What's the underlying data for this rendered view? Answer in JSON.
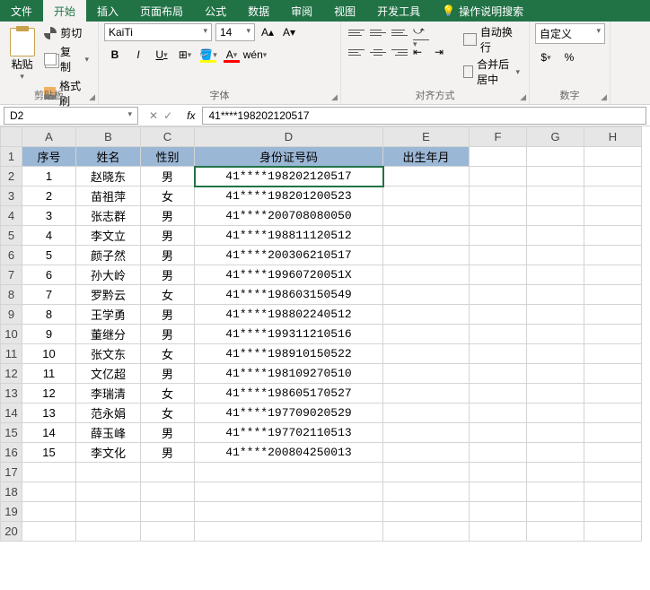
{
  "tabs": {
    "file": "文件",
    "home": "开始",
    "insert": "插入",
    "layout": "页面布局",
    "formula": "公式",
    "data": "数据",
    "review": "审阅",
    "view": "视图",
    "dev": "开发工具",
    "tell": "操作说明搜索"
  },
  "ribbon": {
    "paste": "粘贴",
    "cut": "剪切",
    "copy": "复制",
    "painter": "格式刷",
    "clipboard": "剪贴板",
    "fontName": "KaiTi",
    "fontSize": "14",
    "fontGroup": "字体",
    "b": "B",
    "i": "I",
    "u": "U",
    "wen": "wén",
    "wrap": "自动换行",
    "merge": "合并后居中",
    "alignGroup": "对齐方式",
    "numFormat": "自定义",
    "numGroup": "数字"
  },
  "nameBox": "D2",
  "formula": "41****198202120517",
  "columns": [
    "A",
    "B",
    "C",
    "D",
    "E",
    "F",
    "G",
    "H"
  ],
  "headers": {
    "c1": "序号",
    "c2": "姓名",
    "c3": "性别",
    "c4": "身份证号码",
    "c5": "出生年月"
  },
  "rows": [
    {
      "n": "1",
      "name": "赵晓东",
      "sex": "男",
      "id": "41****198202120517"
    },
    {
      "n": "2",
      "name": "苗祖萍",
      "sex": "女",
      "id": "41****198201200523"
    },
    {
      "n": "3",
      "name": "张志群",
      "sex": "男",
      "id": "41****200708080050"
    },
    {
      "n": "4",
      "name": "李文立",
      "sex": "男",
      "id": "41****198811120512"
    },
    {
      "n": "5",
      "name": "颜子然",
      "sex": "男",
      "id": "41****200306210517"
    },
    {
      "n": "6",
      "name": "孙大岭",
      "sex": "男",
      "id": "41****19960720051X"
    },
    {
      "n": "7",
      "name": "罗黔云",
      "sex": "女",
      "id": "41****198603150549"
    },
    {
      "n": "8",
      "name": "王学勇",
      "sex": "男",
      "id": "41****198802240512"
    },
    {
      "n": "9",
      "name": "董继分",
      "sex": "男",
      "id": "41****199311210516"
    },
    {
      "n": "10",
      "name": "张文东",
      "sex": "女",
      "id": "41****198910150522"
    },
    {
      "n": "11",
      "name": "文亿超",
      "sex": "男",
      "id": "41****198109270510"
    },
    {
      "n": "12",
      "name": "李瑞清",
      "sex": "女",
      "id": "41****198605170527"
    },
    {
      "n": "13",
      "name": "范永娟",
      "sex": "女",
      "id": "41****197709020529"
    },
    {
      "n": "14",
      "name": "薛玉峰",
      "sex": "男",
      "id": "41****197702110513"
    },
    {
      "n": "15",
      "name": "李文化",
      "sex": "男",
      "id": "41****200804250013"
    }
  ],
  "chart_data": {
    "type": "table",
    "columns": [
      "序号",
      "姓名",
      "性别",
      "身份证号码",
      "出生年月"
    ],
    "data": [
      [
        1,
        "赵晓东",
        "男",
        "41****198202120517",
        ""
      ],
      [
        2,
        "苗祖萍",
        "女",
        "41****198201200523",
        ""
      ],
      [
        3,
        "张志群",
        "男",
        "41****200708080050",
        ""
      ],
      [
        4,
        "李文立",
        "男",
        "41****198811120512",
        ""
      ],
      [
        5,
        "颜子然",
        "男",
        "41****200306210517",
        ""
      ],
      [
        6,
        "孙大岭",
        "男",
        "41****19960720051X",
        ""
      ],
      [
        7,
        "罗黔云",
        "女",
        "41****198603150549",
        ""
      ],
      [
        8,
        "王学勇",
        "男",
        "41****198802240512",
        ""
      ],
      [
        9,
        "董继分",
        "男",
        "41****199311210516",
        ""
      ],
      [
        10,
        "张文东",
        "女",
        "41****198910150522",
        ""
      ],
      [
        11,
        "文亿超",
        "男",
        "41****198109270510",
        ""
      ],
      [
        12,
        "李瑞清",
        "女",
        "41****198605170527",
        ""
      ],
      [
        13,
        "范永娟",
        "女",
        "41****197709020529",
        ""
      ],
      [
        14,
        "薛玉峰",
        "男",
        "41****197702110513",
        ""
      ],
      [
        15,
        "李文化",
        "男",
        "41****200804250013",
        ""
      ]
    ]
  }
}
